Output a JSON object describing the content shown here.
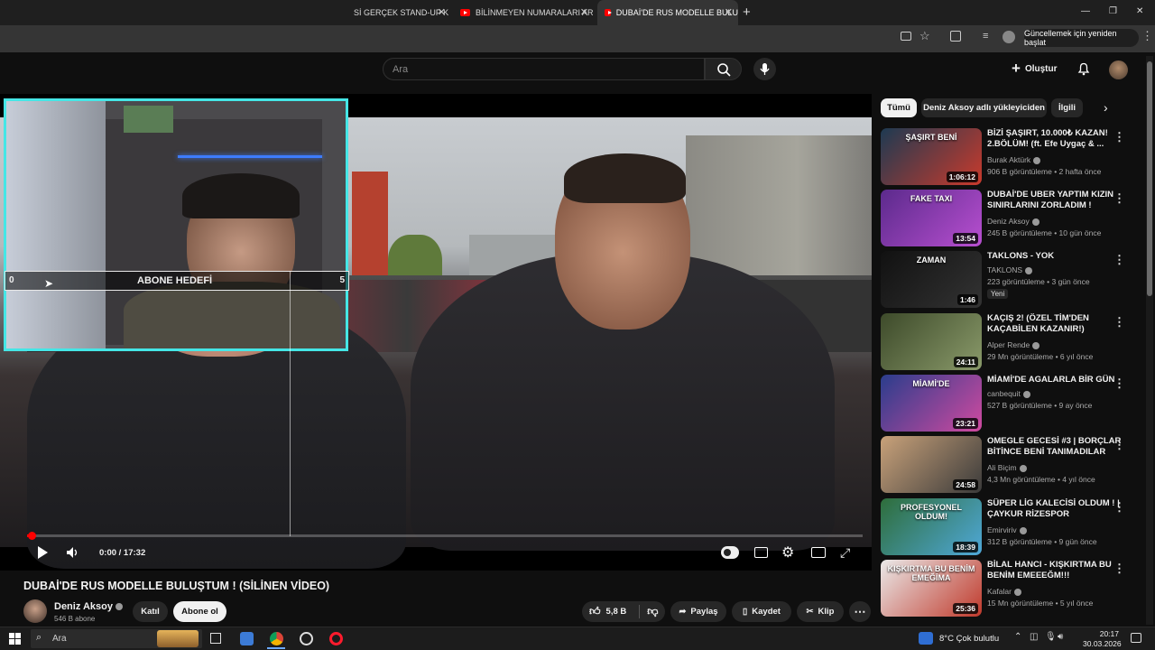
{
  "browser": {
    "tabs": [
      {
        "label": "Sİ GERÇEK STAND-UP K"
      },
      {
        "label": "BİLİNMEYEN NUMARALARI AR"
      },
      {
        "label": "DUBAİ'DE RUS MODELLE BULU"
      }
    ],
    "new_tab": "+",
    "update_button": "Güncellemek için yeniden başlat",
    "window_controls": {
      "minimize": "—",
      "restore": "❐",
      "close": "✕"
    }
  },
  "header": {
    "search_placeholder": "Ara",
    "create_label": "Oluştur"
  },
  "overlay": {
    "sub_goal_start": "0",
    "sub_goal_label": "ABONE HEDEFİ",
    "sub_goal_end": "5",
    "sub_goal_progress": 0.0
  },
  "player": {
    "time": "0:00 / 17:32",
    "progress": 0.01
  },
  "video": {
    "title": "DUBAİ'DE RUS MODELLE BULUŞTUM ! (SİLİNEN VİDEO)",
    "channel": "Deniz Aksoy",
    "subscribers": "546 B abone",
    "join_label": "Katıl",
    "subscribe_label": "Abone ol",
    "likes": "5,8 B",
    "share_label": "Paylaş",
    "save_label": "Kaydet",
    "clip_label": "Klip"
  },
  "filters": [
    {
      "label": "Tümü",
      "active": true
    },
    {
      "label": "Deniz Aksoy adlı yükleyiciden",
      "active": false
    },
    {
      "label": "İlgili",
      "active": false
    }
  ],
  "recommendations": [
    {
      "title": "BİZİ ŞAŞIRT, 10.000₺ KAZAN! 2.BÖLÜM! (ft. Efe Uygaç & ...",
      "channel": "Burak Aktürk",
      "meta": "906 B görüntüleme • 2 hafta önce",
      "duration": "1:06:12",
      "thumb_text": "ŞAŞIRT BENİ",
      "badge": "",
      "c1": "#1d3a52",
      "c2": "#c93a2c"
    },
    {
      "title": "DUBAİ'DE UBER YAPTIM KIZIN SINIRLARINI ZORLADIM !",
      "channel": "Deniz Aksoy",
      "meta": "245 B görüntüleme • 10 gün önce",
      "duration": "13:54",
      "thumb_text": "FAKE TAXI",
      "badge": "",
      "c1": "#5b2a8c",
      "c2": "#b84fd0"
    },
    {
      "title": "TAKLONS - YOK",
      "channel": "TAKLONS",
      "meta": "223 görüntüleme • 3 gün önce",
      "duration": "1:46",
      "thumb_text": "ZAMAN",
      "badge": "Yeni",
      "c1": "#111",
      "c2": "#333"
    },
    {
      "title": "KAÇIŞ 2! (ÖZEL TİM'DEN KAÇABİLEN KAZANIR!)",
      "channel": "Alper Rende",
      "meta": "29 Mn görüntüleme • 6 yıl önce",
      "duration": "24:11",
      "thumb_text": "",
      "badge": "",
      "c1": "#3d4a2a",
      "c2": "#8a9a6a"
    },
    {
      "title": "MİAMİ'DE AGALARLA BİR GÜN",
      "channel": "canbequit",
      "meta": "527 B görüntüleme • 9 ay önce",
      "duration": "23:21",
      "thumb_text": "MİAMİ'DE",
      "badge": "",
      "c1": "#2a3d8c",
      "c2": "#d04aa0"
    },
    {
      "title": "OMEGLE GECESİ #3 | BORÇLAR BİTİNCE BENİ TANIMADILAR",
      "channel": "Ali Biçim",
      "meta": "4,3 Mn görüntüleme • 4 yıl önce",
      "duration": "24:58",
      "thumb_text": "",
      "badge": "",
      "c1": "#c9a27a",
      "c2": "#3a3a3a"
    },
    {
      "title": "SÜPER LİG KALECİSİ OLDUM ! | ÇAYKUR RİZESPOR",
      "channel": "Emirviriv",
      "meta": "312 B görüntüleme • 9 gün önce",
      "duration": "18:39",
      "thumb_text": "PROFESYONEL OLDUM!",
      "badge": "",
      "c1": "#2e6d3a",
      "c2": "#4fa8d8"
    },
    {
      "title": "BİLAL HANCI - KIŞKIRTMA BU BENİM EMEEEĞM!!!",
      "channel": "Kafalar",
      "meta": "15 Mn görüntüleme • 5 yıl önce",
      "duration": "25:36",
      "thumb_text": "KIŞKIRTMA BU BENİM EMEĞİMA",
      "badge": "",
      "c1": "#eaeaea",
      "c2": "#c0392b"
    }
  ],
  "taskbar": {
    "search_placeholder": "Ara",
    "weather": "8°C  Çok bulutlu",
    "time": "20:17",
    "date": "30.03.2026"
  },
  "colors": {
    "accent": "#ff0000",
    "webcam_border": "#45e6e6",
    "bg": "#0f0f0f"
  }
}
